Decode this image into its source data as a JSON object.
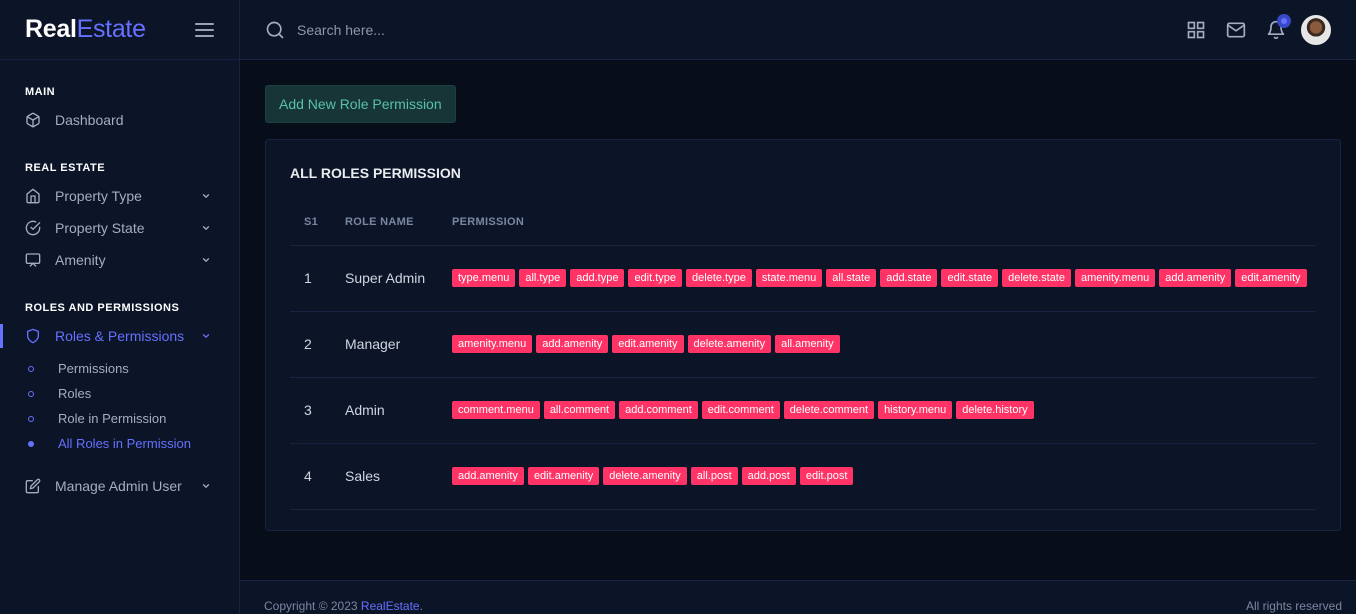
{
  "brand": {
    "part1": "Real",
    "part2": "Estate"
  },
  "sidebar": {
    "sections": [
      {
        "label": "MAIN"
      },
      {
        "label": "REAL ESTATE"
      },
      {
        "label": "ROLES AND PERMISSIONS"
      }
    ],
    "dashboard": "Dashboard",
    "property_type": "Property Type",
    "property_state": "Property State",
    "amenity": "Amenity",
    "roles_permissions": "Roles & Permissions",
    "sub_items": [
      "Permissions",
      "Roles",
      "Role in Permission",
      "All Roles in Permission"
    ],
    "manage_admin": "Manage Admin User"
  },
  "search": {
    "placeholder": "Search here..."
  },
  "colors": {
    "accent": "#6571ff",
    "badge": "#ff3366",
    "button_text": "#59c0ab"
  },
  "main": {
    "add_button": "Add New Role Permission",
    "card_title": "ALL ROLES PERMISSION",
    "columns": [
      "S1",
      "ROLE NAME",
      "PERMISSION"
    ],
    "rows": [
      {
        "sl": "1",
        "role": "Super Admin",
        "permissions": [
          "type.menu",
          "all.type",
          "add.type",
          "edit.type",
          "delete.type",
          "state.menu",
          "all.state",
          "add.state",
          "edit.state",
          "delete.state",
          "amenity.menu",
          "add.amenity",
          "edit.amenity"
        ]
      },
      {
        "sl": "2",
        "role": "Manager",
        "permissions": [
          "amenity.menu",
          "add.amenity",
          "edit.amenity",
          "delete.amenity",
          "all.amenity"
        ]
      },
      {
        "sl": "3",
        "role": "Admin",
        "permissions": [
          "comment.menu",
          "all.comment",
          "add.comment",
          "edit.comment",
          "delete.comment",
          "history.menu",
          "delete.history"
        ]
      },
      {
        "sl": "4",
        "role": "Sales",
        "permissions": [
          "add.amenity",
          "edit.amenity",
          "delete.amenity",
          "all.post",
          "add.post",
          "edit.post"
        ]
      }
    ]
  },
  "footer": {
    "copyright": "Copyright © 2023 ",
    "brand_link": "RealEstate",
    "period": ".",
    "rights": "All rights reserved"
  }
}
